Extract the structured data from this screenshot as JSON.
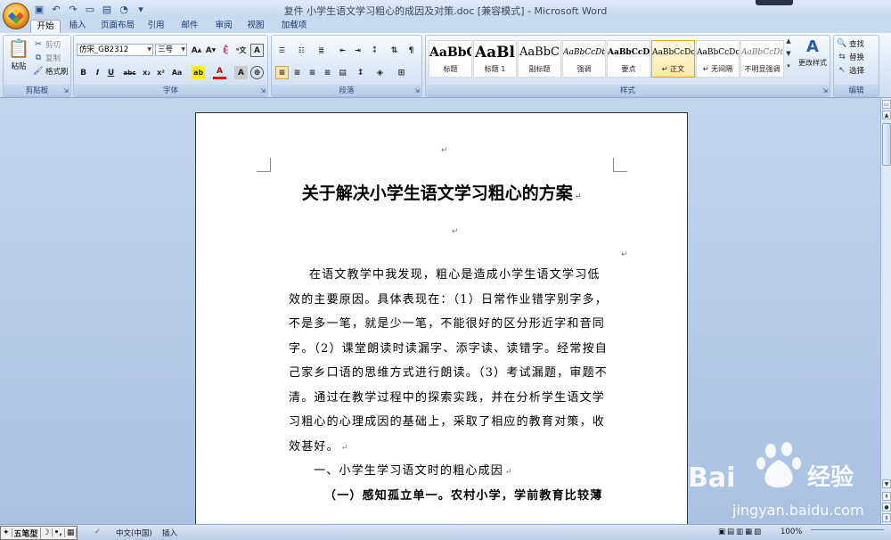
{
  "window": {
    "title": "复件 小学生语文学习粗心的成因及对策.doc [兼容模式] - Microsoft Word"
  },
  "tabs": [
    "开始",
    "插入",
    "页面布局",
    "引用",
    "邮件",
    "审阅",
    "视图",
    "加载项"
  ],
  "clipboard": {
    "paste": "粘贴",
    "cut": "剪切",
    "copy": "复制",
    "painter": "格式刷",
    "group_label": "剪贴板"
  },
  "font": {
    "name": "仿宋_GB2312",
    "size": "三号",
    "group_label": "字体"
  },
  "paragraph": {
    "group_label": "段落"
  },
  "styles": {
    "items": [
      {
        "sample": "AaBbC",
        "name": "标题"
      },
      {
        "sample": "AaBl",
        "name": "标题 1"
      },
      {
        "sample": "AaBbC",
        "name": "副标题"
      },
      {
        "sample": "AaBbCcDt",
        "name": "强调"
      },
      {
        "sample": "AaBbCcD",
        "name": "要点"
      },
      {
        "sample": "AaBbCcDc",
        "name": "↵ 正文"
      },
      {
        "sample": "AaBbCcDc",
        "name": "↵ 无间隔"
      },
      {
        "sample": "AaBbCcDt",
        "name": "不明显强调"
      }
    ],
    "change_label": "更改样式",
    "group_label": "样式"
  },
  "editing": {
    "find": "查找",
    "replace": "替换",
    "select": "选择",
    "group_label": "编辑"
  },
  "document": {
    "title": "关于解决小学生语文学习粗心的方案",
    "lines": [
      "在语文教学中我发现，粗心是造成小学生语文学习低",
      "效的主要原因。具体表现在：（1）日常作业错字别字多，",
      "不是多一笔，就是少一笔，不能很好的区分形近字和音同",
      "字。（2）课堂朗读时读漏字、添字读、读错字。经常按自",
      "己家乡口语的思维方式进行朗读。（3）考试漏题，审题不",
      "清。通过在教学过程中的探索实践，并在分析学生语文学",
      "习粗心的心理成因的基础上，采取了相应的教育对策，收",
      "效甚好。",
      "一、小学生学习语文时的粗心成因",
      "（一）感知孤立单一。农村小学，学前教育比较薄"
    ],
    "return_mark": "↵"
  },
  "statusbar": {
    "ime_items": [
      "五笔型",
      "☽",
      "•,",
      "▦"
    ],
    "language": "中文(中国)",
    "mode": "插入",
    "zoom": "100%"
  },
  "watermark": {
    "brand": "Bai",
    "brand2": "经验",
    "url": "jingyan.baidu.com"
  }
}
